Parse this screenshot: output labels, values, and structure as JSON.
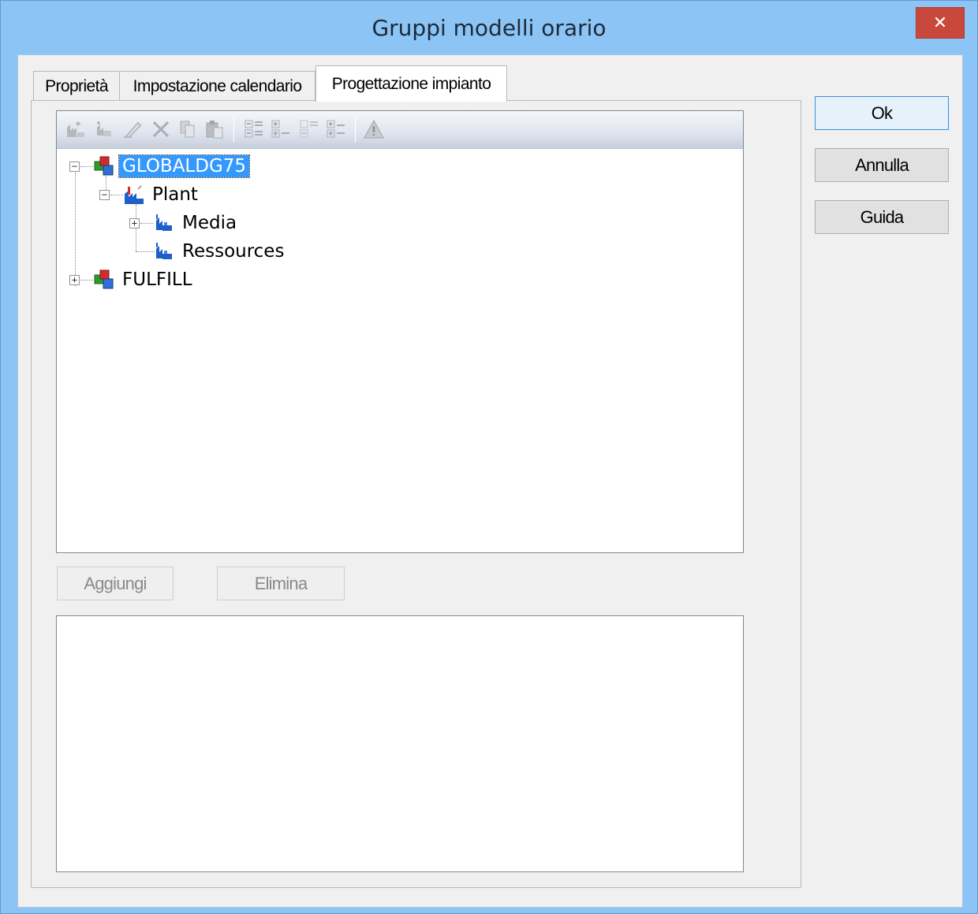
{
  "window": {
    "title": "Gruppi modelli orario",
    "close_glyph": "✕"
  },
  "tabs": [
    {
      "label": "Proprietà",
      "active": false
    },
    {
      "label": "Impostazione calendario",
      "active": false
    },
    {
      "label": "Progettazione impianto",
      "active": true
    }
  ],
  "toolbar": {
    "icons": [
      "add-plant-icon",
      "add-subplant-icon",
      "edit-icon",
      "delete-icon",
      "copy-icon",
      "paste-icon",
      "expand-all-icon",
      "collapse-icon",
      "expand-icon",
      "collapse-all-icon",
      "warning-icon"
    ]
  },
  "tree": {
    "nodes": [
      {
        "label": "GLOBALDG75",
        "level": 0,
        "expander": "−",
        "icon": "plant-group-icon",
        "selected": true
      },
      {
        "label": "Plant",
        "level": 1,
        "expander": "−",
        "icon": "plant-icon",
        "selected": false
      },
      {
        "label": "Media",
        "level": 2,
        "expander": "+",
        "icon": "subplant-icon",
        "selected": false
      },
      {
        "label": "Ressources",
        "level": 2,
        "expander": "",
        "icon": "subplant-icon",
        "selected": false
      },
      {
        "label": "FULFILL",
        "level": 0,
        "expander": "+",
        "icon": "plant-group-icon",
        "selected": false
      }
    ]
  },
  "buttons": {
    "add": "Aggiungi",
    "delete": "Elimina",
    "ok": "Ok",
    "cancel": "Annulla",
    "help": "Guida"
  },
  "colors": {
    "title_bar": "#8bc4f5",
    "close_button": "#c9483c",
    "selection": "#3399ff"
  }
}
